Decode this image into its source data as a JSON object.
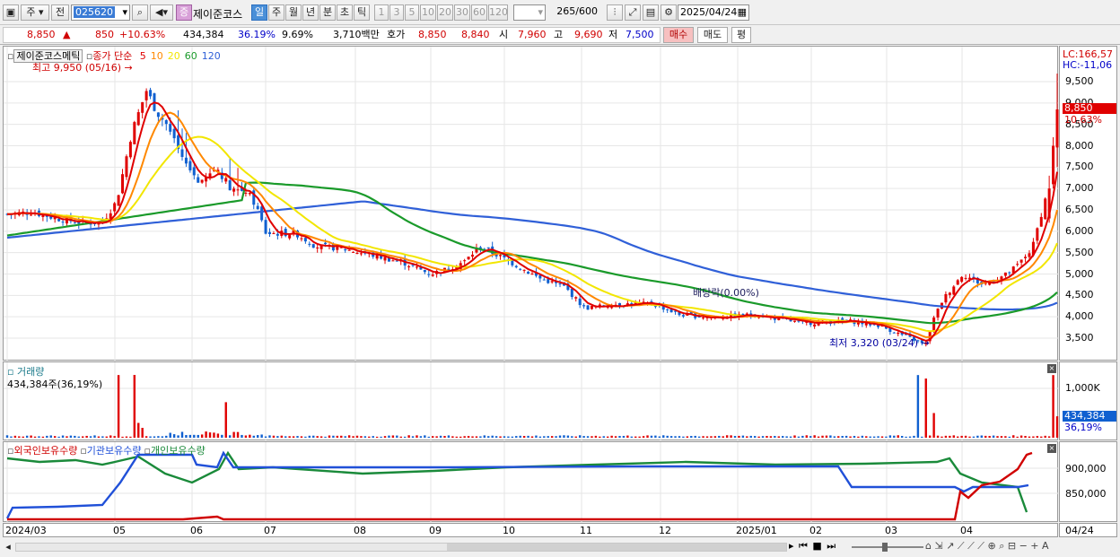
{
  "toolbar": {
    "market_toggle": "주",
    "prev_label": "전",
    "code": "025620",
    "stock_name": "제이준코스",
    "periods": [
      "일",
      "주",
      "월",
      "년",
      "분",
      "초",
      "틱"
    ],
    "intervals": [
      "1",
      "3",
      "5",
      "10",
      "20",
      "30",
      "60",
      "120"
    ],
    "count": "265",
    "count_total": "/600",
    "date": "2025/04/24"
  },
  "quote": {
    "price": "8,850",
    "arrow": "▲",
    "change": "850",
    "change_pct": "+10.63%",
    "volume": "434,384",
    "vol_ratio": "36.19%",
    "turnover": "9.69%",
    "amount": "3,710백만",
    "bid_label": "호가",
    "ask": "8,850",
    "bid": "8,840",
    "open_label": "시",
    "open": "7,960",
    "high_label": "고",
    "high": "9,690",
    "low_label": "저",
    "low": "7,500",
    "buy_btn": "매수",
    "sell_btn": "매도",
    "eval_btn": "평"
  },
  "price_panel": {
    "name_tag": "제이준코스메틱",
    "ma_label": "종가 단순",
    "ma_periods": [
      {
        "p": "5",
        "color": "#e00000"
      },
      {
        "p": "10",
        "color": "#ff8800"
      },
      {
        "p": "20",
        "color": "#f2e600"
      },
      {
        "p": "60",
        "color": "#1a9a2a"
      },
      {
        "p": "120",
        "color": "#3060d8"
      }
    ],
    "high_note": "최고 9,950 (05/16)",
    "low_note": "최저 3,320 (03/24)",
    "dividend_note": "배당락(0.00%)",
    "lc": "LC:166,57",
    "hc": "HC:-11,06",
    "current_tag": "8,850",
    "current_pct": "10.63%",
    "y_ticks": [
      "9,500",
      "9,000",
      "8,500",
      "8,000",
      "7,500",
      "7,000",
      "6,500",
      "6,000",
      "5,500",
      "5,000",
      "4,500",
      "4,000",
      "3,500"
    ]
  },
  "volume_panel": {
    "title": "거래량",
    "value": "434,384주(36,19%)",
    "tick": "1,000K",
    "current_tag": "434,384",
    "current_pct": "36,19%"
  },
  "holding_panel": {
    "legends": [
      {
        "label": "외국인보유수량",
        "color": "#d00000"
      },
      {
        "label": "기관보유수량",
        "color": "#2050d8"
      },
      {
        "label": "개인보유수량",
        "color": "#1a8a3a"
      }
    ],
    "ticks": [
      "900,000",
      "850,000"
    ]
  },
  "x_labels": [
    "2024/03",
    "05",
    "06",
    "07",
    "08",
    "09",
    "10",
    "11",
    "12",
    "2025/01",
    "02",
    "03",
    "04"
  ],
  "x_right": "04/24",
  "colors": {
    "up": "#e00000",
    "down": "#1060d0",
    "accent": "#4a8fd8"
  }
}
